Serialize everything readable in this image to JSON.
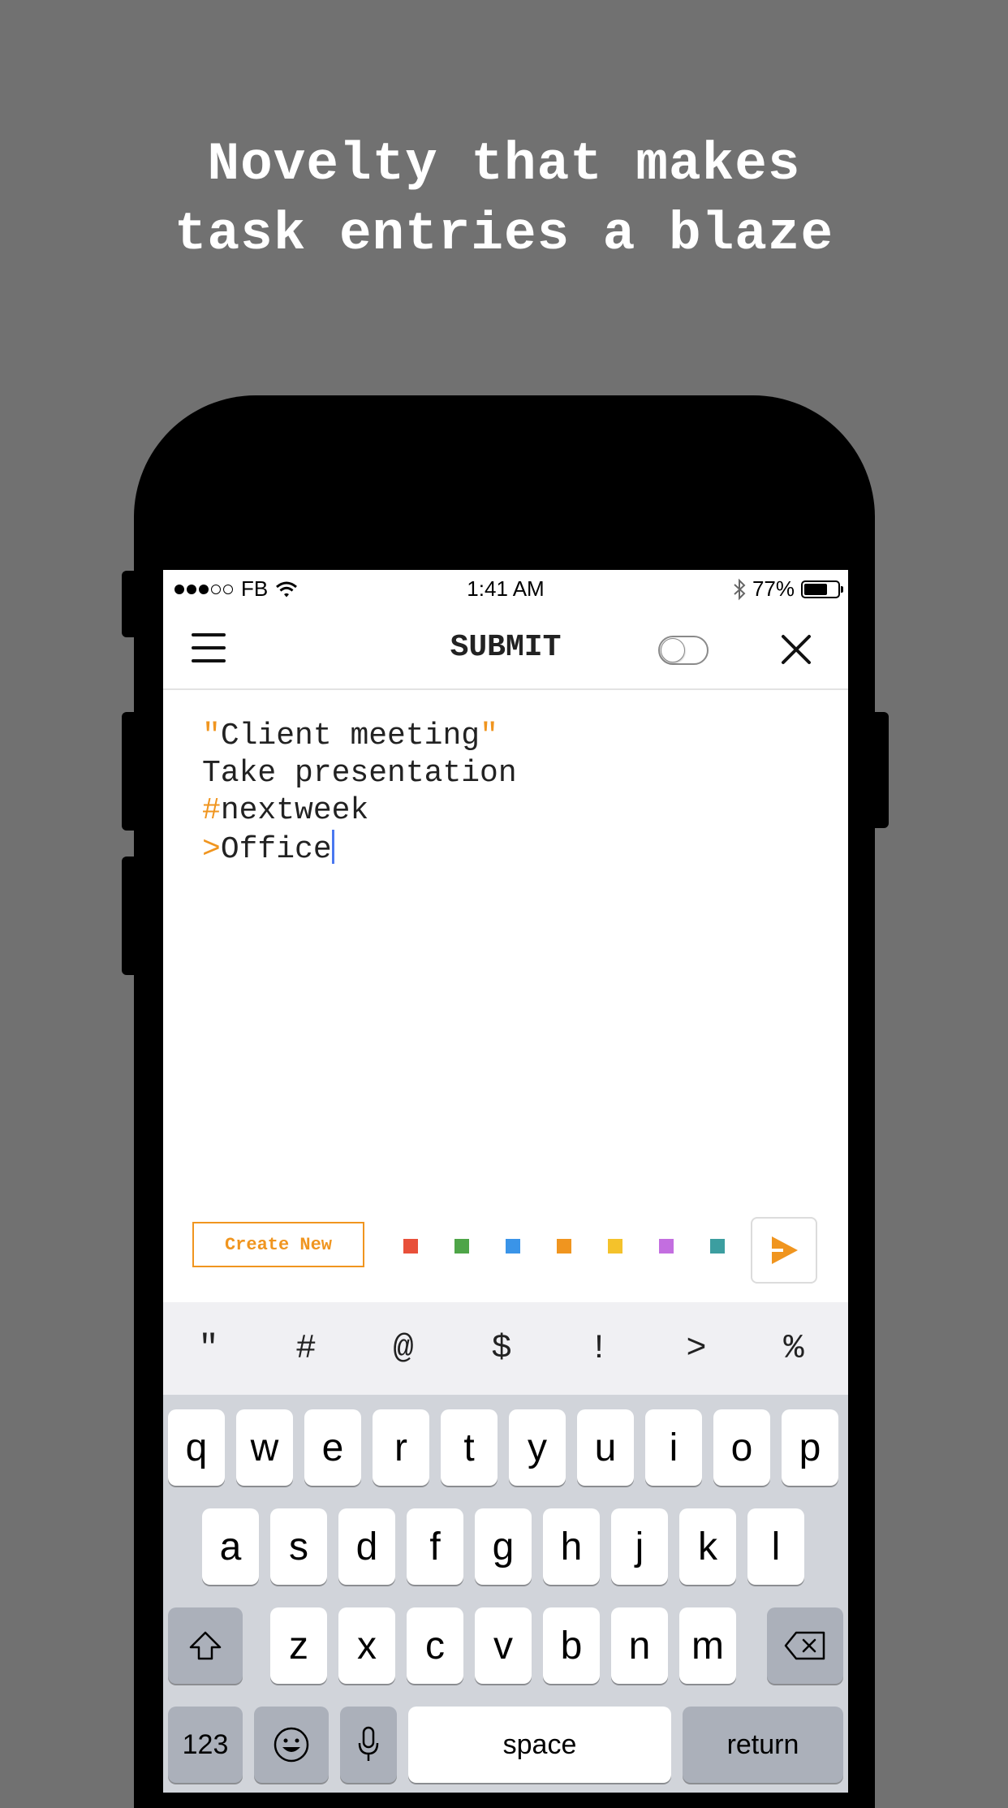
{
  "headline": {
    "line1": "Novelty that makes",
    "line2": "task entries a blaze"
  },
  "status_bar": {
    "carrier": "FB",
    "time": "1:41 AM",
    "battery": "77%"
  },
  "nav": {
    "title": "SUBMIT"
  },
  "editor": {
    "line1": {
      "open_quote": "\"",
      "text": "Client meeting",
      "close_quote": "\""
    },
    "line2": "Take presentation",
    "line3": {
      "prefix": "#",
      "text": "nextweek"
    },
    "line4": {
      "prefix": ">",
      "text": "Office"
    }
  },
  "toolbar": {
    "create_label": "Create New",
    "colors": [
      "#e8503a",
      "#4ea548",
      "#3a94e8",
      "#f0951f",
      "#f4c22b",
      "#c36ee0",
      "#3c9ea0"
    ]
  },
  "symbols": [
    "\"",
    "#",
    "@",
    "$",
    "!",
    ">",
    "%"
  ],
  "keyboard": {
    "row1": [
      "q",
      "w",
      "e",
      "r",
      "t",
      "y",
      "u",
      "i",
      "o",
      "p"
    ],
    "row2": [
      "a",
      "s",
      "d",
      "f",
      "g",
      "h",
      "j",
      "k",
      "l"
    ],
    "row3": [
      "z",
      "x",
      "c",
      "v",
      "b",
      "n",
      "m"
    ],
    "numbers_label": "123",
    "space_label": "space",
    "return_label": "return"
  },
  "accent_color": "#f0951f"
}
